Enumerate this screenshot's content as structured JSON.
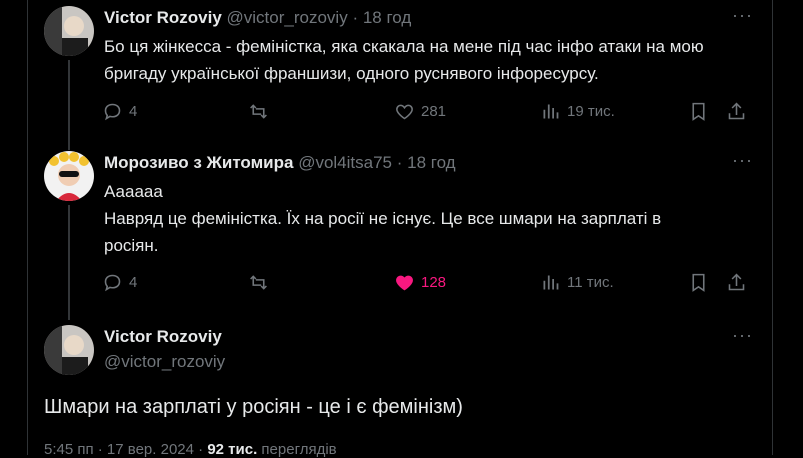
{
  "tweets": [
    {
      "name": "Victor Rozoviy",
      "handle": "@victor_rozoviy",
      "separator": "·",
      "time": "18 год",
      "text": "Бо ця жінкесса - феміністка, яка скакала на мене під час інфо атаки на мою бригаду  української франшизи, одного руснявого інфоресурсу.",
      "replies": "4",
      "reposts": "",
      "likes": "281",
      "views": "19 тис."
    },
    {
      "name": "Морозиво з Житомира",
      "handle": "@vol4itsa75",
      "separator": "·",
      "time": "18 год",
      "text_line1": "Аааааа",
      "text_line2": "Навряд це феміністка. Їх на росії не існує. Це все шмари на зарплаті в росіян.",
      "replies": "4",
      "reposts": "",
      "likes": "128",
      "views": "11 тис."
    }
  ],
  "main": {
    "name": "Victor Rozoviy",
    "handle": "@victor_rozoviy",
    "text": "Шмари на зарплаті у росіян - це і є фемінізм)",
    "time": "5:45 пп · 17 вер. 2024 ·",
    "views": "92 тис.",
    "views_label": "переглядів"
  },
  "icons": [
    "more-icon",
    "reply-icon",
    "repost-icon",
    "like-icon",
    "views-icon",
    "bookmark-icon",
    "share-icon"
  ],
  "colors": {
    "like_active": "#f91880",
    "muted": "#71767b",
    "text": "#e7e9ea"
  }
}
